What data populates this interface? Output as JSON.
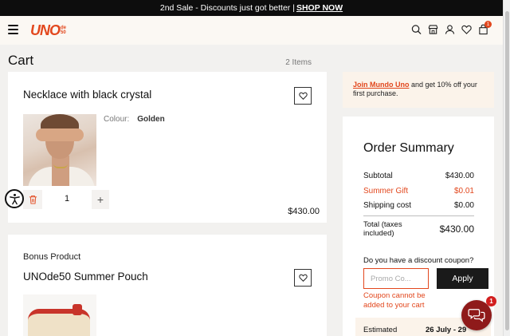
{
  "promo_bar": {
    "text": "2nd Sale - Discounts just got better | ",
    "link": "SHOP NOW"
  },
  "header": {
    "logo_main": "UNO",
    "logo_sup_top": "de",
    "logo_sup_bottom": "50",
    "icons": [
      "search-icon",
      "store-icon",
      "user-icon",
      "heart-icon",
      "bag-icon"
    ],
    "cart_badge": "1"
  },
  "cart": {
    "title": "Cart",
    "items_count": "2 Items",
    "items": [
      {
        "name": "Necklace with black crystal",
        "attr_label": "Colour:",
        "attr_value": "Golden",
        "quantity": "1",
        "plus": "+",
        "price": "$430.00"
      },
      {
        "bonus_label": "Bonus Product",
        "name": "UNOde50 Summer Pouch"
      }
    ]
  },
  "club": {
    "link": "Join Mundo Uno",
    "text": " and get 10% off your first purchase."
  },
  "summary": {
    "title": "Order Summary",
    "subtotal_label": "Subtotal",
    "subtotal_value": "$430.00",
    "gift_label": "Summer Gift",
    "gift_value": "$0.01",
    "shipping_label": "Shipping cost",
    "shipping_value": "$0.00",
    "total_label": "Total (taxes included)",
    "total_value": "$430.00",
    "coupon_question": "Do you have a discount coupon?",
    "promo_placeholder": "Promo Co...",
    "apply_label": "Apply",
    "coupon_error": "Coupon cannot be added to your cart",
    "estimated_label": "Estimated",
    "estimated_value": "26 July - 29"
  },
  "chat": {
    "badge": "1"
  },
  "colors": {
    "accent": "#e2471d",
    "dark": "#1a1a1a",
    "chat": "#8f1a1a"
  }
}
